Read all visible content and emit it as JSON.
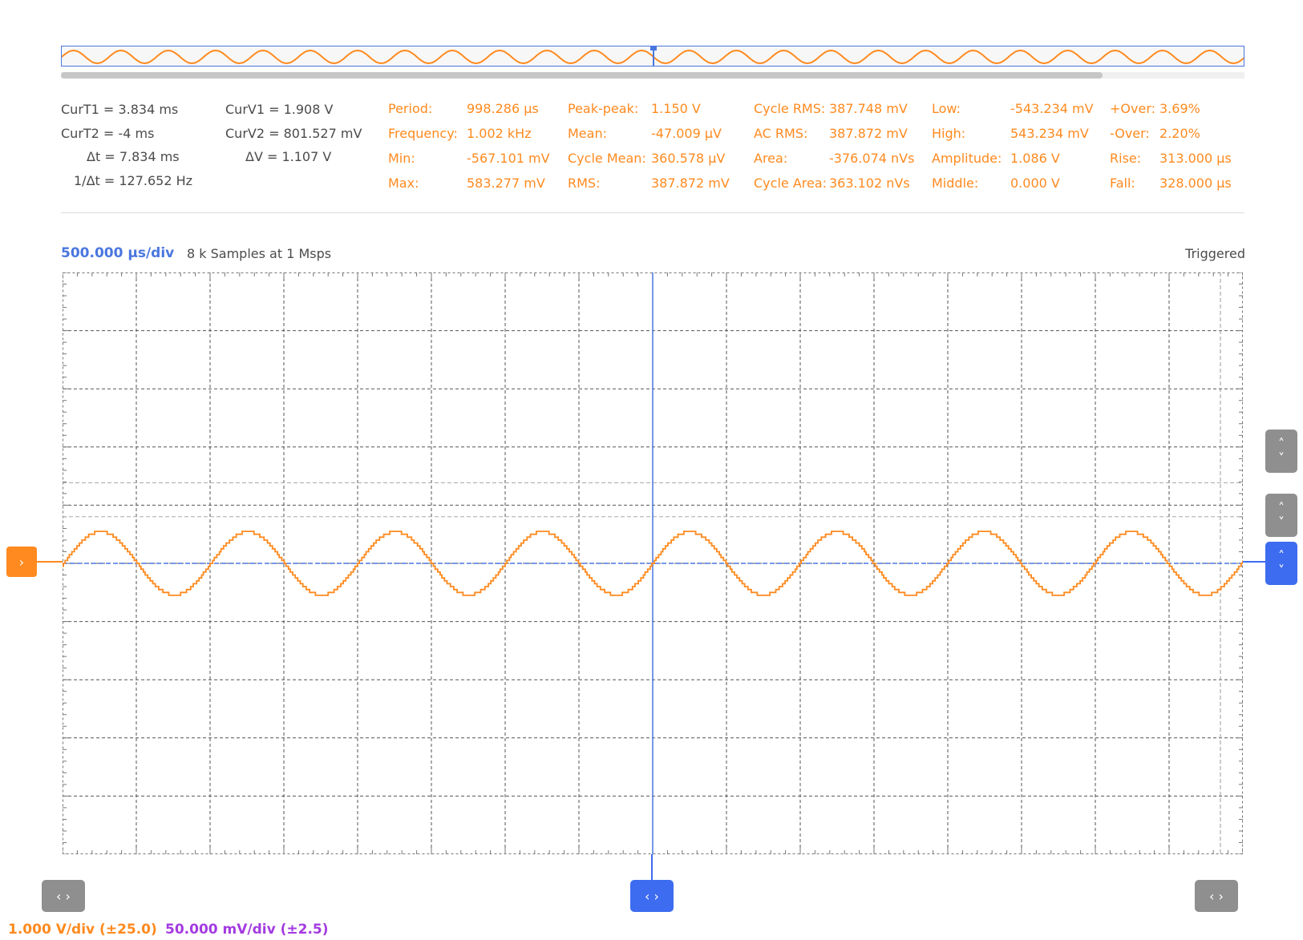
{
  "cursors": {
    "curT1": {
      "label": "CurT1 =",
      "value": "3.834 ms"
    },
    "curT2": {
      "label": "CurT2 =",
      "value": "-4 ms"
    },
    "deltaT": {
      "label": "Δt =",
      "value": "7.834 ms"
    },
    "invDeltaT": {
      "label": "1/Δt =",
      "value": "127.652 Hz"
    },
    "curV1": {
      "label": "CurV1 =",
      "value": "1.908 V"
    },
    "curV2": {
      "label": "CurV2 =",
      "value": "801.527 mV"
    },
    "deltaV": {
      "label": "ΔV =",
      "value": "1.107 V"
    }
  },
  "measurements": [
    [
      {
        "label": "Period:",
        "value": "998.286 μs"
      },
      {
        "label": "Frequency:",
        "value": "1.002 kHz"
      },
      {
        "label": "Min:",
        "value": "-567.101 mV"
      },
      {
        "label": "Max:",
        "value": "583.277 mV"
      }
    ],
    [
      {
        "label": "Peak-peak:",
        "value": "1.150 V"
      },
      {
        "label": "Mean:",
        "value": "-47.009 μV"
      },
      {
        "label": "Cycle Mean:",
        "value": "360.578 μV"
      },
      {
        "label": "RMS:",
        "value": "387.872 mV"
      }
    ],
    [
      {
        "label": "Cycle RMS:",
        "value": "387.748 mV"
      },
      {
        "label": "AC RMS:",
        "value": "387.872 mV"
      },
      {
        "label": "Area:",
        "value": "-376.074 nVs"
      },
      {
        "label": "Cycle Area:",
        "value": "363.102 nVs"
      }
    ],
    [
      {
        "label": "Low:",
        "value": "-543.234 mV"
      },
      {
        "label": "High:",
        "value": "543.234 mV"
      },
      {
        "label": "Amplitude:",
        "value": "1.086 V"
      },
      {
        "label": "Middle:",
        "value": "0.000 V"
      }
    ],
    [
      {
        "label": "+Over:",
        "value": "3.69%"
      },
      {
        "label": "-Over:",
        "value": "2.20%"
      },
      {
        "label": "Rise:",
        "value": "313.000 μs"
      },
      {
        "label": "Fall:",
        "value": "328.000 μs"
      }
    ]
  ],
  "acquisition": {
    "timebase": "500.000 μs/div",
    "samples": "8 k Samples at 1 Msps",
    "status": "Triggered"
  },
  "channels": {
    "ch1_scale": "1.000 V/div (±25.0)",
    "ch2_scale": "50.000 mV/div (±2.5)"
  },
  "controls": {
    "h_button_glyph": "‹ ›",
    "v_up_glyph": "˄",
    "v_down_glyph": "˅",
    "ch1_marker_glyph": "›"
  },
  "colors": {
    "ch1": "#ff8a1f",
    "ch2": "#a33be0",
    "accent": "#4a76e0",
    "grid": "#555555"
  },
  "chart_data": {
    "type": "line",
    "series": [
      {
        "waveform": "sine",
        "frequency_hz": 1002,
        "amplitude_v": 0.543,
        "offset_v": 0.0
      }
    ],
    "x_range_s": [
      -0.004,
      0.004
    ],
    "y_range_v": [
      -5,
      5
    ],
    "divisions": {
      "x": 16,
      "y": 10
    },
    "grid": true,
    "overview": {
      "cycles_shown": 25,
      "scroll_fraction": 0.88
    }
  }
}
